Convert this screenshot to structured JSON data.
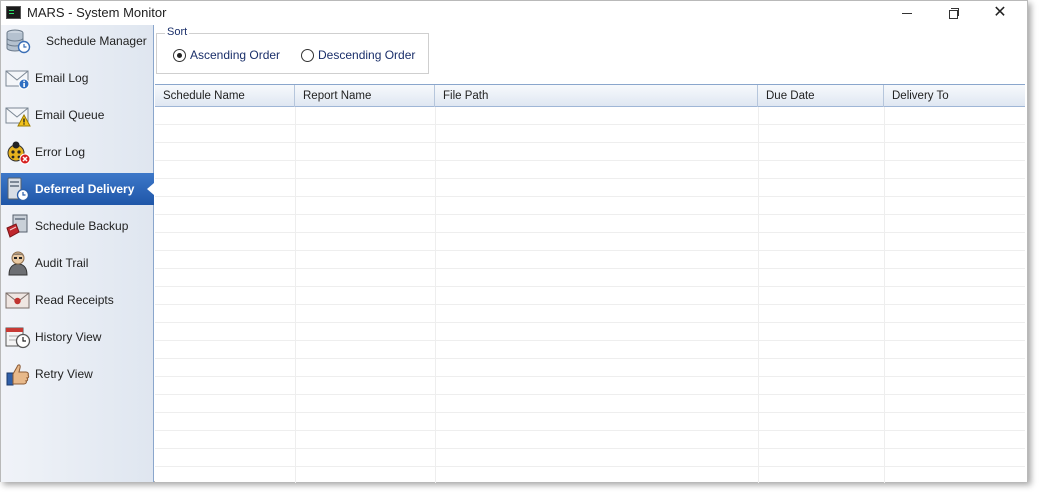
{
  "window": {
    "title": "MARS - System Monitor",
    "controls": {
      "minimize": "minimize",
      "maximize": "restore",
      "close": "close"
    }
  },
  "sidebar": {
    "items": [
      {
        "label": "Schedule Manager",
        "icon": "database-clock-icon",
        "active": false
      },
      {
        "label": "Email Log",
        "icon": "envelope-info-icon",
        "active": false
      },
      {
        "label": "Email Queue",
        "icon": "envelope-warning-icon",
        "active": false
      },
      {
        "label": "Error Log",
        "icon": "ladybug-error-icon",
        "active": false
      },
      {
        "label": "Deferred Delivery",
        "icon": "server-clock-icon",
        "active": true
      },
      {
        "label": "Schedule Backup",
        "icon": "backup-box-icon",
        "active": false
      },
      {
        "label": "Audit Trail",
        "icon": "auditor-icon",
        "active": false
      },
      {
        "label": "Read Receipts",
        "icon": "envelope-receipt-icon",
        "active": false
      },
      {
        "label": "History View",
        "icon": "calendar-clock-icon",
        "active": false
      },
      {
        "label": "Retry View",
        "icon": "thumbs-up-icon",
        "active": false
      }
    ]
  },
  "sort": {
    "legend": "Sort",
    "options": [
      {
        "label": "Ascending Order",
        "checked": true
      },
      {
        "label": "Descending Order",
        "checked": false
      }
    ]
  },
  "grid": {
    "columns": [
      "Schedule Name",
      "Report Name",
      "File Path",
      "Due Date",
      "Delivery To"
    ],
    "rows": []
  },
  "colors": {
    "accent": "#2b64b8",
    "sidebar_bg": "#e4eaf3",
    "label_text": "#1a2f6a",
    "header_border": "#8aa6cc"
  }
}
